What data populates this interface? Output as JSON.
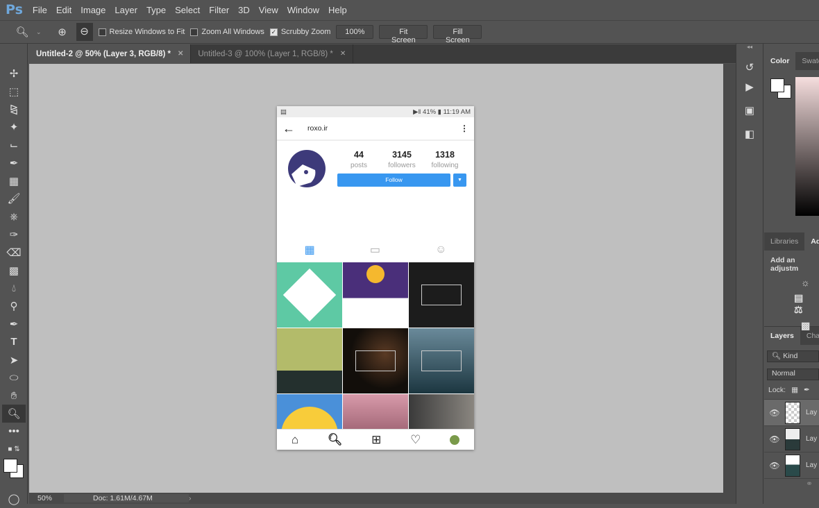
{
  "app": {
    "logo": "Ps",
    "menu": [
      "File",
      "Edit",
      "Image",
      "Layer",
      "Type",
      "Select",
      "Filter",
      "3D",
      "View",
      "Window",
      "Help"
    ]
  },
  "options": {
    "resize_windows": "Resize Windows to Fit",
    "resize_checked": false,
    "zoom_all": "Zoom All Windows",
    "zoom_all_checked": false,
    "scrubby": "Scrubby Zoom",
    "scrubby_checked": true,
    "zoom_value": "100%",
    "fit_screen": "Fit Screen",
    "fill_screen": "Fill Screen"
  },
  "tabs": [
    {
      "label": "Untitled-2 @ 50% (Layer 3, RGB/8) *",
      "active": true
    },
    {
      "label": "Untitled-3 @ 100% (Layer 1, RGB/8) *",
      "active": false
    }
  ],
  "tools": [
    "move",
    "rectangular-marquee",
    "lasso",
    "magic-wand",
    "crop",
    "eyedropper",
    "healing-brush",
    "brush",
    "clone-stamp",
    "history-brush",
    "eraser",
    "gradient",
    "blur",
    "dodge",
    "pen",
    "type",
    "path-selection",
    "ellipse",
    "hand",
    "zoom",
    "more"
  ],
  "status": {
    "zoom": "50%",
    "doc": "Doc: 1.61M/4.67M"
  },
  "phone": {
    "status_time": "11:19 AM",
    "battery": "41%",
    "username": "roxo.ir",
    "posts": "44",
    "posts_label": "posts",
    "followers": "3145",
    "followers_label": "followers",
    "following": "1318",
    "following_label": "following",
    "follow": "Follow",
    "accent": "#3897f0",
    "avatar_color": "#3d3a7a",
    "grid_colors": [
      "#5ec9a4",
      "#4a2f7a",
      "#1c1c1c",
      "#9aa85a",
      "#1a1410",
      "#2c4e5c",
      "#4a90d9",
      "#c07090",
      "#6a6660"
    ]
  },
  "panels": {
    "color_tab": "Color",
    "swatches_tab": "Swatc",
    "libraries_tab": "Libraries",
    "adjust_tab": "Ad",
    "adjust_title": "Add an adjustm",
    "layers_tab": "Layers",
    "channels_tab": "Chan",
    "kind": "Kind",
    "blend": "Normal",
    "lock": "Lock:",
    "layers": [
      "Lay",
      "Lay",
      "Lay"
    ]
  }
}
